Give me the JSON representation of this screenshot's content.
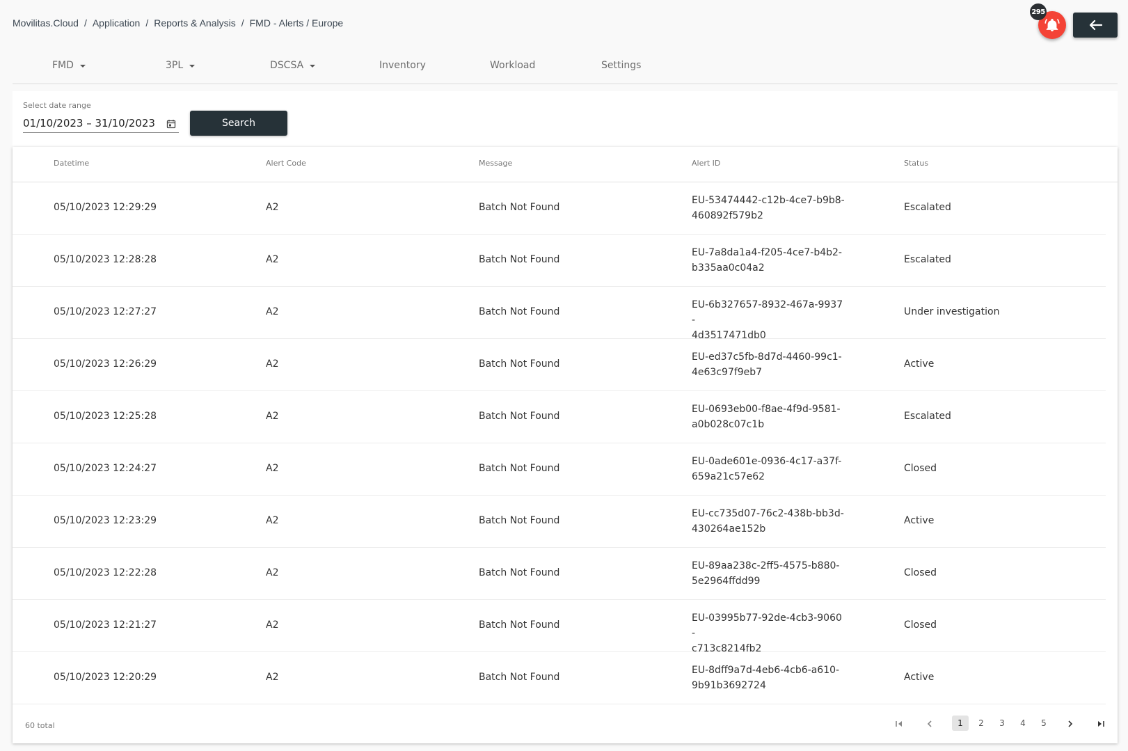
{
  "breadcrumb": {
    "items": [
      "Movilitas.Cloud",
      "Application",
      "Reports & Analysis",
      "FMD - Alerts / Europe"
    ],
    "separator": "/"
  },
  "notifications": {
    "count": "295",
    "icon": "bell-icon",
    "color": "#f44336"
  },
  "back_button": {
    "icon": "arrow-left-icon"
  },
  "nav": {
    "items": [
      {
        "label": "FMD",
        "has_dropdown": true
      },
      {
        "label": "3PL",
        "has_dropdown": true
      },
      {
        "label": "DSCSA",
        "has_dropdown": true
      },
      {
        "label": "Inventory",
        "has_dropdown": false
      },
      {
        "label": "Workload",
        "has_dropdown": false
      },
      {
        "label": "Settings",
        "has_dropdown": false
      }
    ]
  },
  "filter": {
    "date_label": "Select date range",
    "date_value": "01/10/2023 – 31/10/2023",
    "calendar_icon": "calendar-icon",
    "search_label": "Search"
  },
  "table": {
    "columns": [
      "Datetime",
      "Alert Code",
      "Message",
      "Alert ID",
      "Status"
    ],
    "rows": [
      {
        "datetime": "05/10/2023 12:29:29",
        "code": "A2",
        "message": "Batch Not Found",
        "alert_id_1": "EU-53474442-c12b-4ce7-b9b8-",
        "alert_id_2": "460892f579b2",
        "status": "Escalated"
      },
      {
        "datetime": "05/10/2023 12:28:28",
        "code": "A2",
        "message": "Batch Not Found",
        "alert_id_1": "EU-7a8da1a4-f205-4ce7-b4b2-",
        "alert_id_2": "b335aa0c04a2",
        "status": "Escalated"
      },
      {
        "datetime": "05/10/2023 12:27:27",
        "code": "A2",
        "message": "Batch Not Found",
        "alert_id_1": "EU-6b327657-8932-467a-9937-",
        "alert_id_2": "4d3517471db0",
        "status": "Under investigation"
      },
      {
        "datetime": "05/10/2023 12:26:29",
        "code": "A2",
        "message": "Batch Not Found",
        "alert_id_1": "EU-ed37c5fb-8d7d-4460-99c1-",
        "alert_id_2": "4e63c97f9eb7",
        "status": "Active"
      },
      {
        "datetime": "05/10/2023 12:25:28",
        "code": "A2",
        "message": "Batch Not Found",
        "alert_id_1": "EU-0693eb00-f8ae-4f9d-9581-",
        "alert_id_2": "a0b028c07c1b",
        "status": "Escalated"
      },
      {
        "datetime": "05/10/2023 12:24:27",
        "code": "A2",
        "message": "Batch Not Found",
        "alert_id_1": "EU-0ade601e-0936-4c17-a37f-",
        "alert_id_2": "659a21c57e62",
        "status": "Closed"
      },
      {
        "datetime": "05/10/2023 12:23:29",
        "code": "A2",
        "message": "Batch Not Found",
        "alert_id_1": "EU-cc735d07-76c2-438b-bb3d-",
        "alert_id_2": "430264ae152b",
        "status": "Active"
      },
      {
        "datetime": "05/10/2023 12:22:28",
        "code": "A2",
        "message": "Batch Not Found",
        "alert_id_1": "EU-89aa238c-2ff5-4575-b880-",
        "alert_id_2": "5e2964ffdd99",
        "status": "Closed"
      },
      {
        "datetime": "05/10/2023 12:21:27",
        "code": "A2",
        "message": "Batch Not Found",
        "alert_id_1": "EU-03995b77-92de-4cb3-9060-",
        "alert_id_2": "c713c8214fb2",
        "status": "Closed"
      },
      {
        "datetime": "05/10/2023 12:20:29",
        "code": "A2",
        "message": "Batch Not Found",
        "alert_id_1": "EU-8dff9a7d-4eb6-4cb6-a610-",
        "alert_id_2": "9b91b3692724",
        "status": "Active"
      }
    ]
  },
  "pagination": {
    "total_text": "60 total",
    "pages": [
      "1",
      "2",
      "3",
      "4",
      "5"
    ],
    "current_page": "1"
  },
  "colors": {
    "primary_dark": "#263238",
    "notification_red": "#f44336"
  }
}
